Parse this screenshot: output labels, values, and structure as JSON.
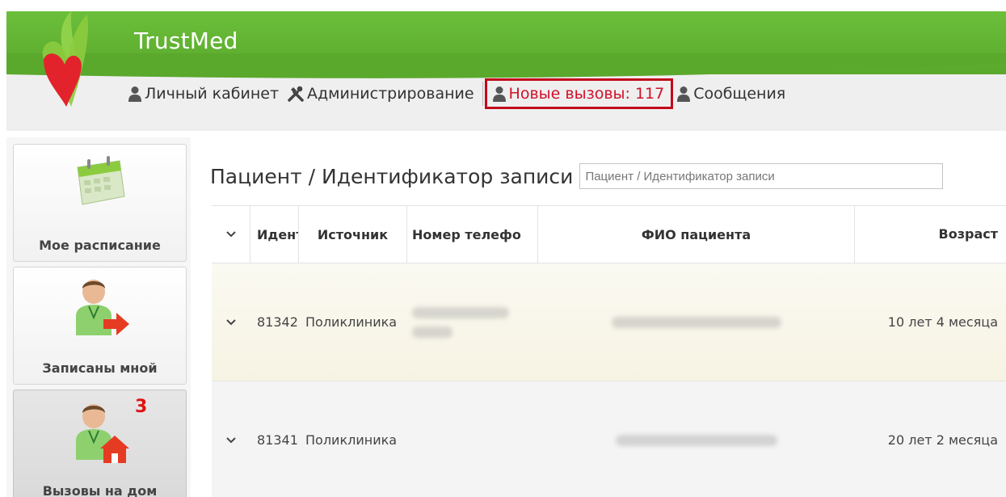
{
  "app": {
    "brand": "TrustMed",
    "colors": {
      "header_green": "#5aa82c",
      "highlight_red": "#c20a1a",
      "badge_red": "#e01212"
    }
  },
  "topnav": {
    "personal_cabinet": {
      "label": "Личный кабинет",
      "icon": "user-icon"
    },
    "administration": {
      "label": "Администрирование",
      "icon": "tools-icon"
    },
    "new_calls": {
      "label": "Новые вызовы: 117",
      "icon": "user-icon"
    },
    "messages": {
      "label": "Сообщения",
      "icon": "user-icon"
    }
  },
  "sidebar": {
    "items": [
      {
        "label": "Мое расписание",
        "icon": "calendar-icon"
      },
      {
        "label": "Записаны мной",
        "icon": "doctor-arrow-icon"
      },
      {
        "label": "Вызовы на дом",
        "icon": "doctor-home-icon",
        "badge": "3"
      }
    ]
  },
  "search": {
    "label": "Пациент / Идентификатор записи",
    "placeholder": "Пациент / Идентификатор записи"
  },
  "table": {
    "columns": [
      "",
      "Идентификатор",
      "Источник",
      "Номер телефона",
      "ФИО пациента",
      "Возраст"
    ],
    "column_visible": [
      "",
      "Иденти",
      "Источник",
      "Номер телефо",
      "ФИО пациента",
      "Возраст"
    ],
    "rows": [
      {
        "id": "81342",
        "source": "Поликлиника",
        "phone": "",
        "name": "",
        "age": "10 лет 4 месяца"
      },
      {
        "id": "81341",
        "source": "Поликлиника",
        "phone": "",
        "name": "",
        "age": "20 лет 2 месяца"
      }
    ]
  }
}
